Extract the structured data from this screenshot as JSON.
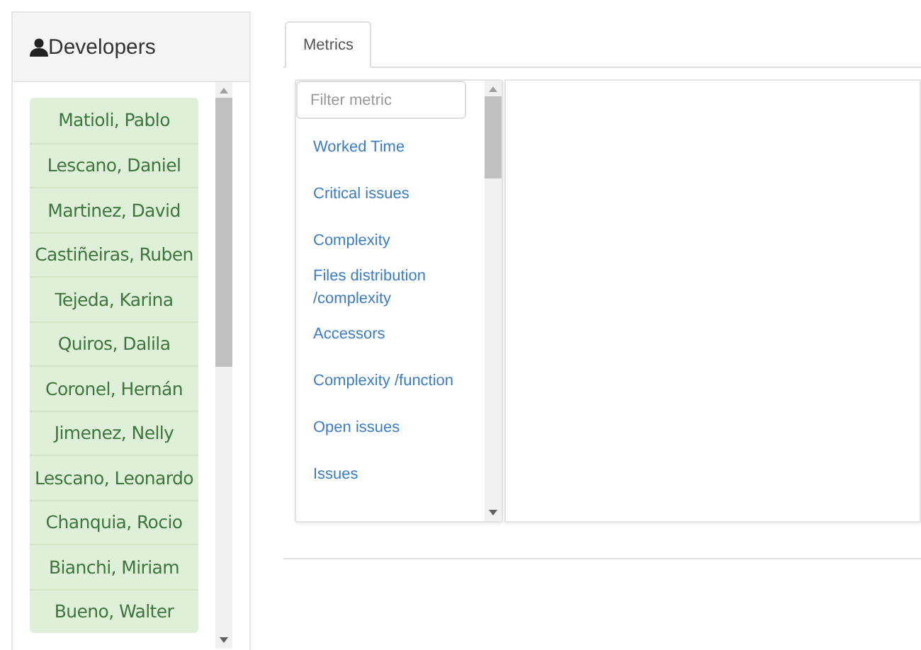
{
  "developers_panel": {
    "title": "Developers",
    "items": [
      "Matioli, Pablo",
      "Lescano, Daniel",
      "Martinez, David",
      "Castiñeiras, Ruben",
      "Tejeda, Karina",
      "Quiros, Dalila",
      "Coronel, Hernán",
      "Jimenez, Nelly",
      "Lescano, Leonardo",
      "Chanquia, Rocio",
      "Bianchi, Miriam",
      "Bueno, Walter"
    ]
  },
  "tabs": [
    {
      "label": "Metrics",
      "selected": true
    }
  ],
  "metrics": {
    "filter": {
      "placeholder": "Filter metric"
    },
    "items": [
      "Worked Time",
      "Critical issues",
      "Complexity",
      "Files distribution /complexity",
      "Accessors",
      "Complexity /function",
      "Open issues",
      "Issues"
    ]
  }
}
